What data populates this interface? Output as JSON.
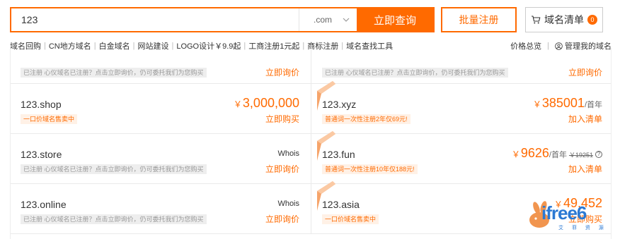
{
  "search": {
    "value": "123",
    "tld": ".com",
    "query_label": "立即查询"
  },
  "bulk_label": "批量注册",
  "cart": {
    "label": "域名清单",
    "count": "0"
  },
  "links": [
    "域名回购",
    "CN地方域名",
    "白金域名",
    "网站建设",
    "LOGO设计￥9.9起",
    "工商注册1元起",
    "商标注册",
    "域名查找工具"
  ],
  "right_links": {
    "price": "价格总览",
    "manage": "管理我的域名"
  },
  "partial_row": {
    "left": {
      "tag": "已注册 心仪域名已注册？点击立即询价，仍可委托我们为您购买",
      "action": "立即询价"
    },
    "right": {
      "tag": "已注册 心仪域名已注册？点击立即询价，仍可委托我们为您购买",
      "action": "立即询价"
    }
  },
  "rows": [
    {
      "left": {
        "domain": "123.shop",
        "price_yen": "￥",
        "price": "3,000,000",
        "tag": "一口价域名售卖中",
        "action": "立即购买"
      },
      "right": {
        "domain": "123.xyz",
        "price_yen": "￥",
        "price": "385001",
        "unit": "/首年",
        "tag": "普通词一次性注册2年仅69元!",
        "action": "加入清单"
      }
    },
    {
      "left": {
        "domain": "123.store",
        "whois": "Whois",
        "tag": "已注册 心仪域名已注册？点击立即询价，仍可委托我们为您购买",
        "action": "立即询价"
      },
      "right": {
        "domain": "123.fun",
        "price_yen": "￥",
        "price": "9626",
        "unit": "/首年",
        "old_price": "￥19251",
        "help": "?",
        "tag": "普通词一次性注册10年仅188元!",
        "action": "加入清单"
      }
    },
    {
      "left": {
        "domain": "123.online",
        "whois": "Whois",
        "tag": "已注册 心仪域名已注册？点击立即询价，仍可委托我们为您购买",
        "action": "立即询价"
      },
      "right": {
        "domain": "123.asia",
        "price_yen": "￥",
        "price": "49,452",
        "tag": "一口价域名售卖中",
        "action": "立即购买"
      }
    }
  ],
  "watermark": {
    "text": "ifree6",
    "sub": "艾 菲 资 源"
  },
  "colors": {
    "accent": "#ff6a00",
    "tag_bg": "#fff1e6",
    "watermark": "#2b79d3"
  }
}
